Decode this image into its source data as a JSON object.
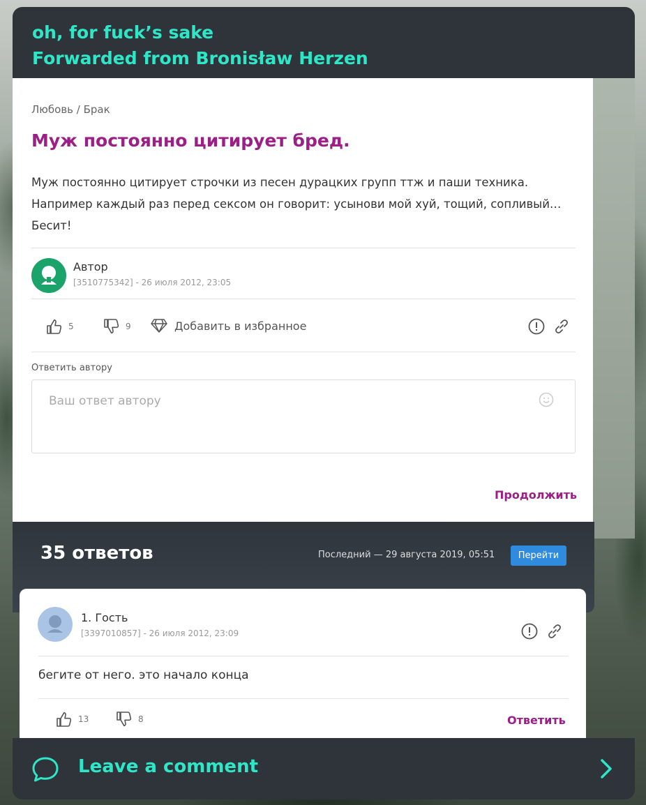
{
  "header": {
    "message": "oh, for fuck’s sake",
    "forwarded_from": "Forwarded from Bronisław Herzen"
  },
  "post": {
    "breadcrumb": "Любовь / Брак",
    "title": "Муж постоянно цитирует бред.",
    "body": "Муж постоянно цитирует строчки из песен дурацких групп ттж и паши техника. Например каждый раз перед сексом он говорит: усынови мой хуй, тощий, сопливый… Бесит!",
    "author_name": "Автор",
    "author_meta": "[3510775342] - 26 июля 2012, 23:05",
    "likes": "5",
    "dislikes": "9",
    "favorite_label": "Добавить в избранное",
    "reply_label": "Ответить автору",
    "reply_placeholder": "Ваш ответ автору",
    "continue_label": "Продолжить"
  },
  "answers": {
    "count_label": "35 ответов",
    "last_label": "Последний — 29 августа 2019, 05:51",
    "go_label": "Перейти"
  },
  "comment": {
    "name": "1. Гость",
    "meta": "[3397010857] - 26 июля 2012, 23:09",
    "text": "бегите от него. это начало конца",
    "likes": "13",
    "dislikes": "8",
    "reply_label": "Ответить"
  },
  "footer": {
    "label": "Leave a comment",
    "icon": "comment-bubble-icon"
  },
  "colors": {
    "accent_teal": "#2ee6c8",
    "dark_panel": "#2e3439",
    "title_magenta": "#9c1e87",
    "button_blue": "#2f8bde",
    "avatar_green": "#1aa36a",
    "avatar_blue": "#a9c4e4"
  }
}
